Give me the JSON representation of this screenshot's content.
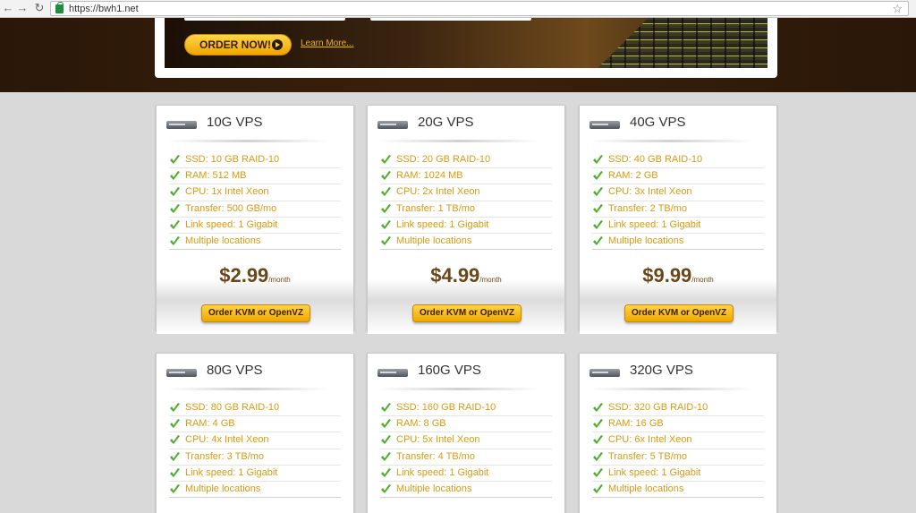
{
  "browser": {
    "url": "https://bwh1.net"
  },
  "banner": {
    "order_now": "ORDER NOW!",
    "learn_more": "Learn More..."
  },
  "plans": [
    {
      "title": "10G VPS",
      "features": [
        "SSD: 10 GB RAID-10",
        "RAM: 512 MB",
        "CPU: 1x Intel Xeon",
        "Transfer: 500 GB/mo",
        "Link speed: 1 Gigabit",
        "Multiple locations"
      ],
      "price": "$2.99",
      "per": "/month",
      "button": "Order KVM or OpenVZ"
    },
    {
      "title": "20G VPS",
      "features": [
        "SSD: 20 GB RAID-10",
        "RAM: 1024 MB",
        "CPU: 2x Intel Xeon",
        "Transfer: 1 TB/mo",
        "Link speed: 1 Gigabit",
        "Multiple locations"
      ],
      "price": "$4.99",
      "per": "/month",
      "button": "Order KVM or OpenVZ"
    },
    {
      "title": "40G VPS",
      "features": [
        "SSD: 40 GB RAID-10",
        "RAM: 2 GB",
        "CPU: 3x Intel Xeon",
        "Transfer: 2 TB/mo",
        "Link speed: 1 Gigabit",
        "Multiple locations"
      ],
      "price": "$9.99",
      "per": "/month",
      "button": "Order KVM or OpenVZ"
    },
    {
      "title": "80G VPS",
      "features": [
        "SSD: 80 GB RAID-10",
        "RAM: 4 GB",
        "CPU: 4x Intel Xeon",
        "Transfer: 3 TB/mo",
        "Link speed: 1 Gigabit",
        "Multiple locations"
      ]
    },
    {
      "title": "160G VPS",
      "features": [
        "SSD: 160 GB RAID-10",
        "RAM: 8 GB",
        "CPU: 5x Intel Xeon",
        "Transfer: 4 TB/mo",
        "Link speed: 1 Gigabit",
        "Multiple locations"
      ]
    },
    {
      "title": "320G VPS",
      "features": [
        "SSD: 320 GB RAID-10",
        "RAM: 16 GB",
        "CPU: 6x Intel Xeon",
        "Transfer: 5 TB/mo",
        "Link speed: 1 Gigabit",
        "Multiple locations"
      ]
    }
  ],
  "colors": {
    "accent": "#f0a400",
    "feature_text": "#d89a12",
    "price_text": "#6b4616",
    "header_bg": "#3b210c"
  }
}
